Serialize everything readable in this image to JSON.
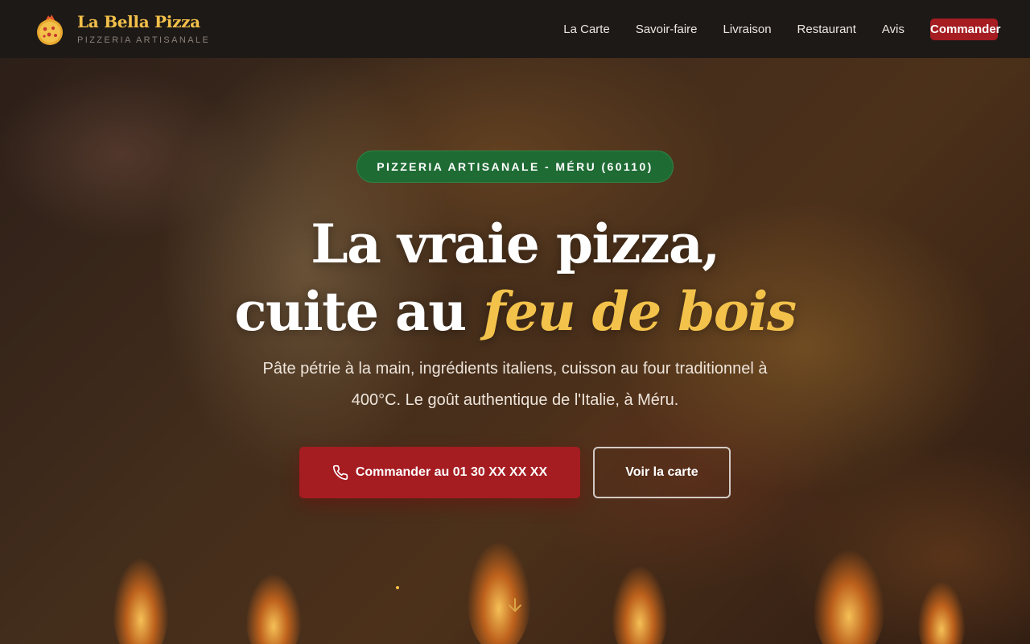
{
  "header": {
    "brand_name": "La Bella Pizza",
    "brand_tagline": "PIZZERIA ARTISANALE",
    "logo_icon": "pizza-logo-icon",
    "nav": [
      {
        "label": "La Carte"
      },
      {
        "label": "Savoir-faire"
      },
      {
        "label": "Livraison"
      },
      {
        "label": "Restaurant"
      },
      {
        "label": "Avis"
      }
    ],
    "cta_label": "Commander"
  },
  "hero": {
    "badge": "PIZZERIA ARTISANALE - MÉRU (60110)",
    "headline_line1": "La vraie pizza,",
    "headline_line2_prefix": "cuite au ",
    "headline_accent": "feu de bois",
    "subtitle": "Pâte pétrie à la main, ingrédients italiens, cuisson au four traditionnel à 400°C. Le goût authentique de l'Italie, à Méru.",
    "primary_cta": "Commander au 01 30 XX XX XX",
    "primary_cta_icon": "phone-icon",
    "secondary_cta": "Voir la carte",
    "scroll_icon": "arrow-down-icon"
  },
  "colors": {
    "accent_gold": "#f3c04a",
    "brand_red": "#a51c21",
    "badge_green": "#1e6b34",
    "header_bg": "#1d1917"
  }
}
